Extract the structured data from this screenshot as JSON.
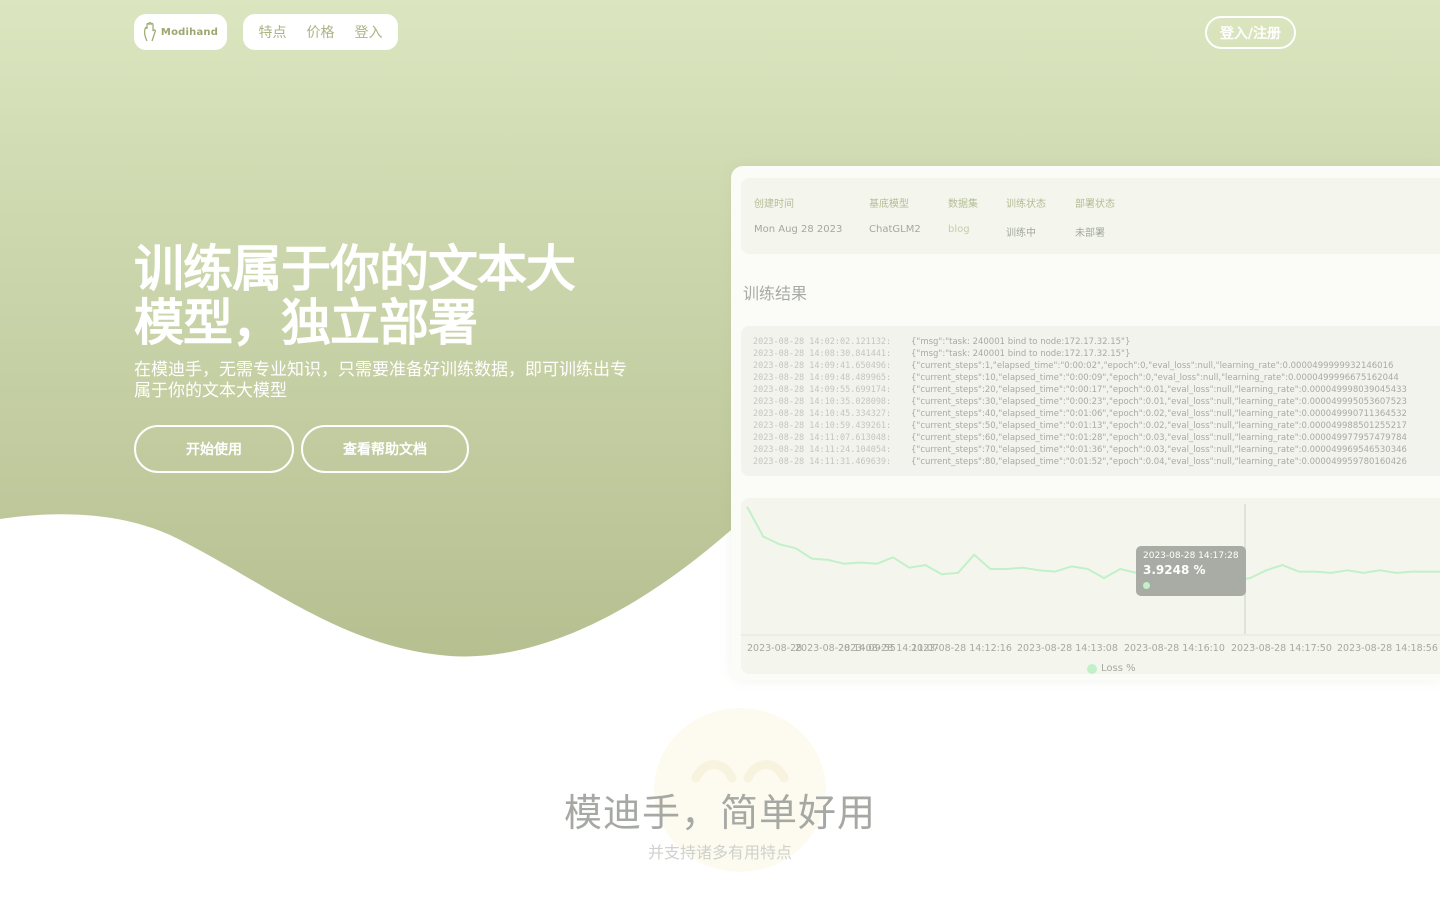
{
  "colors": {
    "hero_top": "#dbe5bf",
    "hero_bottom": "#b5bf90",
    "accent": "#aab482",
    "line": "#c2f0c9"
  },
  "nav": {
    "logo_text": "Modihand",
    "logo_icon": "hand-icon",
    "links": [
      "特点",
      "价格",
      "登入"
    ],
    "login_button": "登入/注册"
  },
  "hero": {
    "title": "训练属于你的文本大模型，独立部署",
    "subtitle": "在模迪手，无需专业知识，只需要准备好训练数据，即可训练出专属于你的文本大模型",
    "start_button": "开始使用",
    "docs_button": "查看帮助文档"
  },
  "preview": {
    "info": {
      "headers": [
        "创建时间",
        "基底模型",
        "数据集",
        "训练状态",
        "部署状态"
      ],
      "values": [
        "Mon Aug 28 2023",
        "ChatGLM2",
        "blog",
        "训练中",
        "未部署"
      ]
    },
    "results_label": "训练结果",
    "logs": [
      {
        "ts": "2023-08-28 14:02:02.121132:",
        "msg": "{\"msg\":\"task: 240001 bind to node:172.17.32.15\"}"
      },
      {
        "ts": "2023-08-28 14:08:30.841441:",
        "msg": "{\"msg\":\"task: 240001 bind to node:172.17.32.15\"}"
      },
      {
        "ts": "2023-08-28 14:09:41.650496:",
        "msg": "{\"current_steps\":1,\"elapsed_time\":\"0:00:02\",\"epoch\":0,\"eval_loss\":null,\"learning_rate\":0.0000499999932146016"
      },
      {
        "ts": "2023-08-28 14:09:48.489965:",
        "msg": "{\"current_steps\":10,\"elapsed_time\":\"0:00:09\",\"epoch\":0,\"eval_loss\":null,\"learning_rate\":0.0000499996675162044"
      },
      {
        "ts": "2023-08-28 14:09:55.699174:",
        "msg": "{\"current_steps\":20,\"elapsed_time\":\"0:00:17\",\"epoch\":0.01,\"eval_loss\":null,\"learning_rate\":0.000049998039045433"
      },
      {
        "ts": "2023-08-28 14:10:35.028098:",
        "msg": "{\"current_steps\":30,\"elapsed_time\":\"0:00:23\",\"epoch\":0.01,\"eval_loss\":null,\"learning_rate\":0.000049995053607523"
      },
      {
        "ts": "2023-08-28 14:10:45.334327:",
        "msg": "{\"current_steps\":40,\"elapsed_time\":\"0:01:06\",\"epoch\":0.02,\"eval_loss\":null,\"learning_rate\":0.000049990711364532"
      },
      {
        "ts": "2023-08-28 14:10:59.439261:",
        "msg": "{\"current_steps\":50,\"elapsed_time\":\"0:01:13\",\"epoch\":0.02,\"eval_loss\":null,\"learning_rate\":0.000049988501255217"
      },
      {
        "ts": "2023-08-28 14:11:07.613048:",
        "msg": "{\"current_steps\":60,\"elapsed_time\":\"0:01:28\",\"epoch\":0.03,\"eval_loss\":null,\"learning_rate\":0.000049977957479784"
      },
      {
        "ts": "2023-08-28 14:11:24.104054:",
        "msg": "{\"current_steps\":70,\"elapsed_time\":\"0:01:36\",\"epoch\":0.03,\"eval_loss\":null,\"learning_rate\":0.000049969546530346"
      },
      {
        "ts": "2023-08-28 14:11:31.469639:",
        "msg": "{\"current_steps\":80,\"elapsed_time\":\"0:01:52\",\"epoch\":0.04,\"eval_loss\":null,\"learning_rate\":0.000049959780160426"
      }
    ],
    "chart": {
      "tooltip_date": "2023-08-28 14:17:28",
      "tooltip_value": "3.9248 %",
      "x_labels": [
        "2023-08-28 14:09:55",
        "2023-08-28 14:11:07",
        "2023-08-28 14:12:16",
        "2023-08-28 14:13:08",
        "2023-08-28 14:16:10",
        "2023-08-28 14:17:50",
        "2023-08-28 14:18:56"
      ],
      "legend": "Loss %"
    }
  },
  "features": {
    "title": "模迪手，简单好用",
    "subtitle": "并支持诸多有用特点"
  },
  "chart_data": {
    "type": "line",
    "title": "",
    "xlabel": "",
    "ylabel": "",
    "series": [
      {
        "name": "Loss %",
        "values": [
          9.8,
          7.5,
          6.9,
          6.6,
          5.8,
          5.7,
          5.4,
          5.5,
          5.4,
          5.9,
          5.1,
          5.3,
          4.6,
          4.7,
          6.1,
          5.0,
          5.0,
          5.1,
          4.9,
          4.8,
          5.2,
          5.0,
          4.3,
          5.0,
          4.7,
          4.9,
          4.6,
          4.4,
          4.5,
          4.6,
          4.1,
          4.3,
          4.9,
          5.3,
          4.8,
          4.8,
          4.7,
          4.9,
          4.7,
          4.9,
          4.7,
          4.8,
          4.8,
          4.8,
          4.9
        ]
      }
    ]
  }
}
